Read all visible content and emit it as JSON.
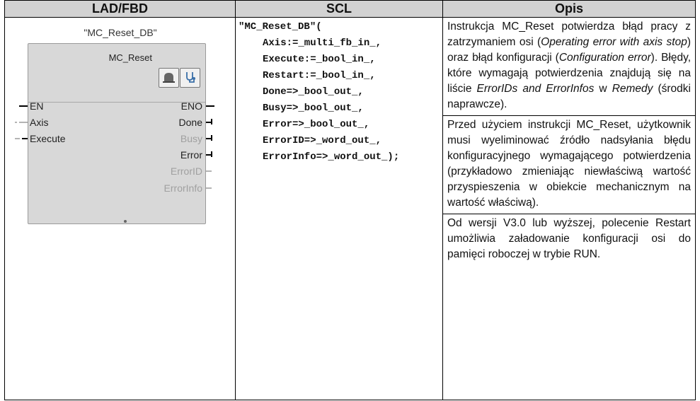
{
  "headers": {
    "lad": "LAD/FBD",
    "scl": "SCL",
    "opis": "Opis"
  },
  "fb": {
    "db_name": "\"MC_Reset_DB\"",
    "title": "MC_Reset",
    "inputs": [
      "EN",
      "Axis",
      "Execute"
    ],
    "outputs": [
      "ENO",
      "Done",
      "Busy",
      "Error",
      "ErrorID",
      "ErrorInfo"
    ],
    "icons": [
      "block-icon",
      "diagnostics-icon"
    ]
  },
  "scl": {
    "lines": [
      "\"MC_Reset_DB\"(",
      "Axis:=_multi_fb_in_,",
      "Execute:=_bool_in_,",
      "Restart:=_bool_in_,",
      "Done=>_bool_out_,",
      "Busy=>_bool_out_,",
      "Error=>_bool_out_,",
      "ErrorID=>_word_out_,",
      "ErrorInfo=>_word_out_);"
    ]
  },
  "opis": {
    "p1": {
      "t1": "Instrukcja MC_Reset potwierdza błąd pracy z zatrzymaniem osi (",
      "i1": "Operating error with axis stop",
      "t2": ") oraz błąd konfiguracji (",
      "i2": "Configuration error",
      "t3": "). Błędy, które wymagają potwierdzenia znajdują się na liście ",
      "i3": "ErrorIDs and ErrorInfos",
      "t4": " w ",
      "i4": "Remedy",
      "t5": " (środki naprawcze)."
    },
    "p2": "Przed użyciem instrukcji MC_Reset, użytkownik musi wyeliminować źródło nadsyłania błędu konfiguracyjnego wymagającego potwierdzenia (przykładowo zmieniając niewłaściwą wartość przyspieszenia w obiekcie mechanicznym na wartość właściwą).",
    "p3": "Od wersji V3.0 lub wyższej, polecenie Restart umożliwia załadowanie konfiguracji osi do pamięci roboczej w trybie RUN."
  }
}
